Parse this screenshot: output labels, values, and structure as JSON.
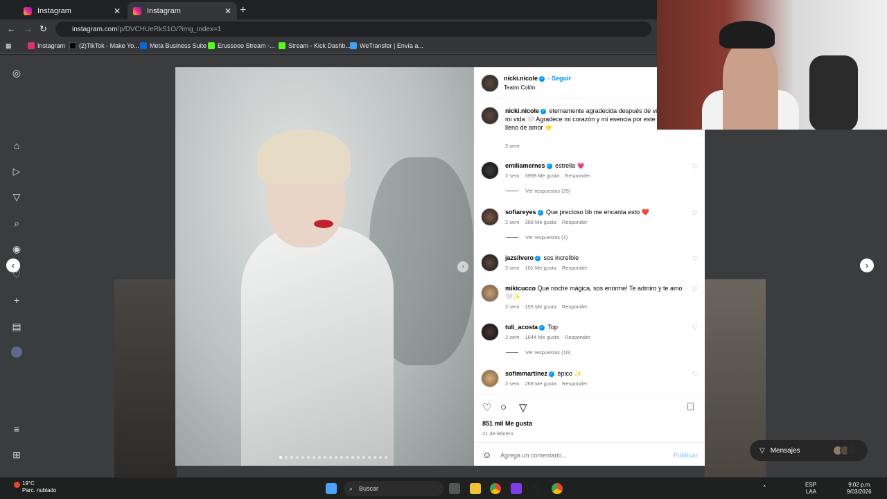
{
  "browser": {
    "tabs": [
      {
        "label": "Instagram",
        "active": false
      },
      {
        "label": "Instagram",
        "active": true
      }
    ],
    "url_site": "instagram.com",
    "url_path": "/p/DVCHUeRkS1O/?img_index=1",
    "bookmarks": [
      {
        "label": "Instagram",
        "color": "#e1306c"
      },
      {
        "label": "(2)TikTok - Make Yo...",
        "color": "#000000"
      },
      {
        "label": "Meta Business Suite",
        "color": "#0668e1"
      },
      {
        "label": "Erussooo Stream -...",
        "color": "#53fc18"
      },
      {
        "label": "Stream - Kick Dashb...",
        "color": "#53fc18"
      },
      {
        "label": "WeTransfer | Envía a...",
        "color": "#409fff"
      }
    ]
  },
  "sidebar": {
    "icons": [
      "instagram-logo-icon",
      "home-icon",
      "reels-icon",
      "send-icon",
      "search-icon",
      "explore-icon",
      "heart-icon",
      "create-icon",
      "dashboard-icon",
      "profile-icon",
      "menu-icon",
      "grid-icon"
    ]
  },
  "post": {
    "username": "nicki.nicole",
    "follow_label": "Seguir",
    "location": "Teatro Colón",
    "caption": "eternamente agradecida después de vi noche de mi vida 🤍 Agradece mi corazón y mi esencia por este encuentro lleno de amor ⭐",
    "caption_time": "2 sem",
    "likes": "851 mil Me gusta",
    "date": "21 de febrero",
    "add_comment_placeholder": "Agrega un comentario...",
    "publish_label": "Publicar"
  },
  "comments": [
    {
      "user": "emiliamernes",
      "verified": true,
      "text": "estrella 💗",
      "time": "2 sem",
      "likes": "3998 Me gusta",
      "reply": "Responder",
      "replies": "Ver respuestas (25)"
    },
    {
      "user": "sofiareyes",
      "verified": true,
      "text": "Que precioso bb me encanta esto ❤️",
      "time": "2 sem",
      "likes": "368 Me gusta",
      "reply": "Responder",
      "replies": "Ver respuestas (1)"
    },
    {
      "user": "jazsilvero",
      "verified": true,
      "text": "sos increíble",
      "time": "2 sem",
      "likes": "101 Me gusta",
      "reply": "Responder",
      "replies": ""
    },
    {
      "user": "mikicucco",
      "verified": false,
      "text": "Que noche mágica, sos enorme! Te admiro y te amo 🤍✨",
      "time": "2 sem",
      "likes": "155 Me gusta",
      "reply": "Responder",
      "replies": ""
    },
    {
      "user": "tuli_acosta",
      "verified": true,
      "text": "Top",
      "time": "2 sem",
      "likes": "1644 Me gusta",
      "reply": "Responder",
      "replies": "Ver respuestas (10)"
    },
    {
      "user": "sofimmartinez",
      "verified": true,
      "text": "épico ✨",
      "time": "2 sem",
      "likes": "269 Me gusta",
      "reply": "Responder",
      "replies": ""
    }
  ],
  "messages_label": "Mensajes",
  "taskbar": {
    "temp": "19°C",
    "weather": "Parc. nublado",
    "search_placeholder": "Buscar",
    "lang": "ESP",
    "lang2": "LAA",
    "time": "9:02 p.m.",
    "date": "9/03/2026"
  }
}
